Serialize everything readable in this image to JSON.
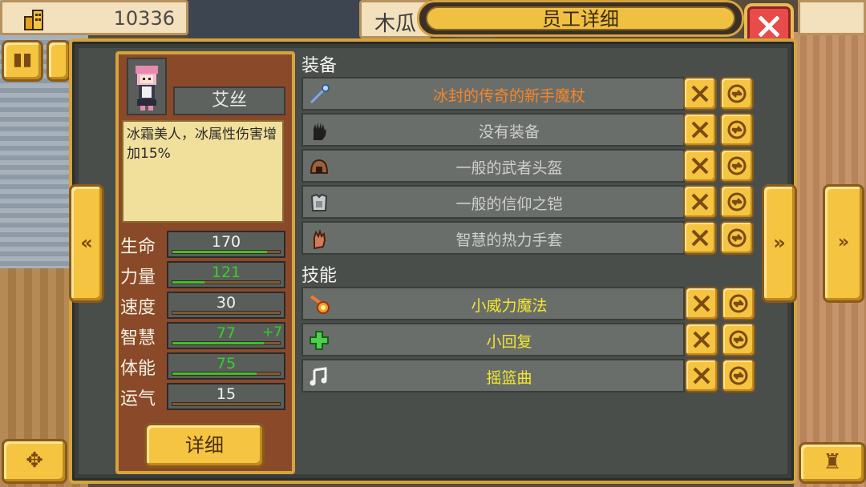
{
  "hud": {
    "money_value": "10336",
    "money_icon": "building-icon"
  },
  "header": {
    "tab_name": "木瓜",
    "title": "员工详细",
    "close_icon": "close-icon"
  },
  "character": {
    "name": "艾丝",
    "description": "冰霜美人，冰属性伤害增加15%",
    "stats": [
      {
        "label": "生命",
        "value": "170",
        "bonus": "",
        "fill": 0.88,
        "highlight": false
      },
      {
        "label": "力量",
        "value": "121",
        "bonus": "",
        "fill": 0.3,
        "highlight": true
      },
      {
        "label": "速度",
        "value": "30",
        "bonus": "",
        "fill": 0.0,
        "highlight": false
      },
      {
        "label": "智慧",
        "value": "77",
        "bonus": "+7",
        "fill": 0.85,
        "highlight": true
      },
      {
        "label": "体能",
        "value": "75",
        "bonus": "",
        "fill": 0.78,
        "highlight": true
      },
      {
        "label": "运气",
        "value": "15",
        "bonus": "",
        "fill": 0.0,
        "highlight": false
      }
    ],
    "detail_button": "详细"
  },
  "equipment": {
    "title": "装备",
    "items": [
      {
        "name": "冰封的传奇的新手魔杖",
        "icon": "wand-icon",
        "color": "#f5862a"
      },
      {
        "name": "没有装备",
        "icon": "glove-slot-icon",
        "color": "#cfcfcf"
      },
      {
        "name": "一般的武者头盔",
        "icon": "helmet-icon",
        "color": "#cfcfcf"
      },
      {
        "name": "一般的信仰之铠",
        "icon": "armor-icon",
        "color": "#cfcfcf"
      },
      {
        "name": "智慧的热力手套",
        "icon": "gauntlet-icon",
        "color": "#cfcfcf"
      }
    ]
  },
  "skills": {
    "title": "技能",
    "items": [
      {
        "name": "小威力魔法",
        "icon": "fireball-icon"
      },
      {
        "name": "小回复",
        "icon": "heal-cross-icon"
      },
      {
        "name": "摇篮曲",
        "icon": "music-note-icon"
      }
    ]
  },
  "colors": {
    "accent": "#f5c440",
    "panel": "#3a3e3a",
    "card": "#8a4a2a",
    "close": "#e94a4a"
  }
}
